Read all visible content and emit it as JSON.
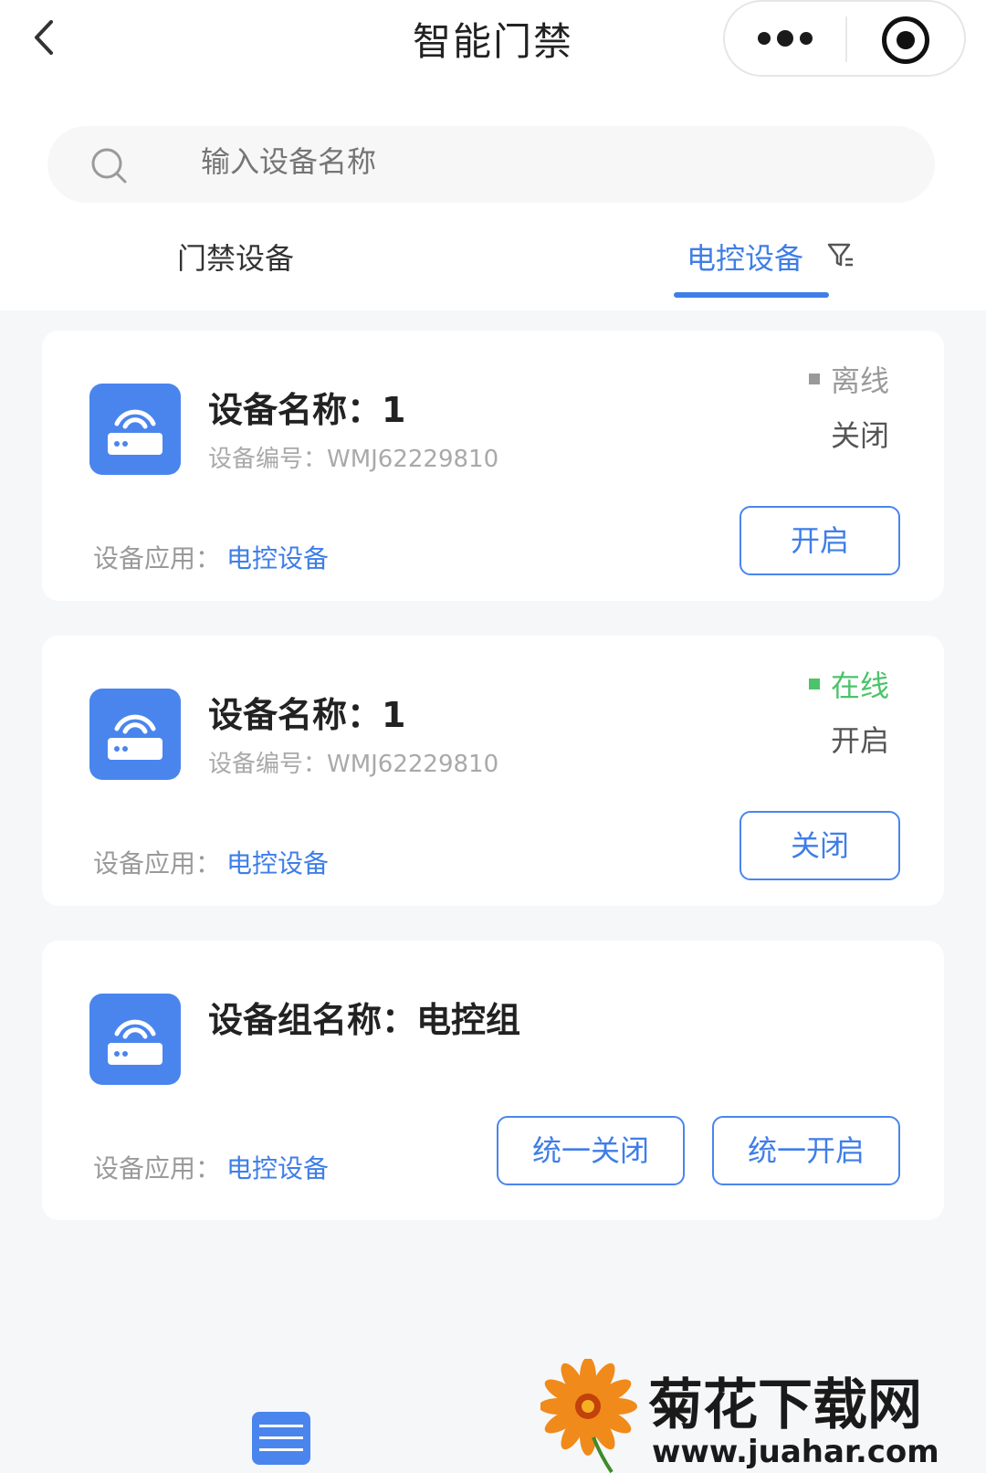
{
  "nav": {
    "title": "智能门禁"
  },
  "search": {
    "placeholder": "输入设备名称"
  },
  "tabs": [
    {
      "label": "门禁设备",
      "active": false
    },
    {
      "label": "电控设备",
      "active": true
    }
  ],
  "colors": {
    "accent": "#3f7ee8",
    "online": "#4cc36b",
    "offline": "#9a9a9a",
    "icon_bg": "#4a85ee"
  },
  "devices": [
    {
      "name": "设备名称：1",
      "code": "设备编号：WMJ62229810",
      "status": "离线",
      "state": "关闭",
      "app_label": "设备应用：",
      "app_value": "电控设备",
      "action": "开启"
    },
    {
      "name": "设备名称：1",
      "code": "设备编号：WMJ62229810",
      "status": "在线",
      "state": "开启",
      "app_label": "设备应用：",
      "app_value": "电控设备",
      "action": "关闭"
    }
  ],
  "group": {
    "name": "设备组名称：电控组",
    "app_label": "设备应用：",
    "app_value": "电控设备",
    "action_close": "统一关闭",
    "action_open": "统一开启"
  },
  "watermark": {
    "title": "菊花下载网",
    "url": "www.juahar.com"
  }
}
